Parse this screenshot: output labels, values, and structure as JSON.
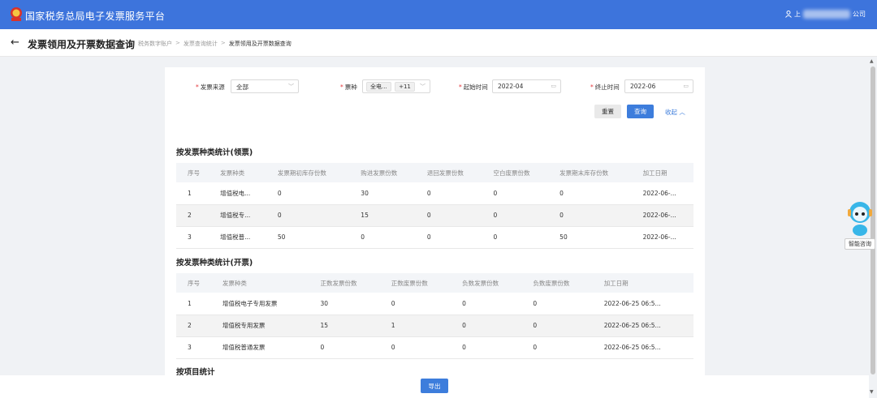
{
  "header": {
    "app_title": "国家税务总局电子发票服务平台",
    "user_prefix": "上",
    "user_suffix": "公司",
    "brand_color": "#3d74dc"
  },
  "pagebar": {
    "title": "发票领用及开票数据查询",
    "breadcrumb": [
      "税务数字账户",
      "发票查询统计",
      "发票领用及开票数据查询"
    ]
  },
  "filters": {
    "source": {
      "label": "发票来源",
      "value": "全部"
    },
    "type": {
      "label": "票种",
      "tag1": "全电...",
      "tag2": "+11"
    },
    "start": {
      "label": "起始时间",
      "value": "2022-04"
    },
    "end": {
      "label": "终止时间",
      "value": "2022-06"
    },
    "reset_label": "重置",
    "query_label": "查询",
    "collapse_label": "收起"
  },
  "section1": {
    "title": "按发票种类统计(领票)",
    "columns": [
      "序号",
      "发票种类",
      "发票期初库存份数",
      "购进发票份数",
      "退回发票份数",
      "空白废票份数",
      "发票期末库存份数",
      "加工日期"
    ],
    "rows": [
      [
        "1",
        "增值税电...",
        "0",
        "30",
        "0",
        "0",
        "0",
        "2022-06-..."
      ],
      [
        "2",
        "增值税专...",
        "0",
        "15",
        "0",
        "0",
        "0",
        "2022-06-..."
      ],
      [
        "3",
        "增值税普...",
        "50",
        "0",
        "0",
        "0",
        "50",
        "2022-06-..."
      ]
    ]
  },
  "section2": {
    "title": "按发票种类统计(开票)",
    "columns": [
      "序号",
      "发票种类",
      "正数发票份数",
      "正数废票份数",
      "负数发票份数",
      "负数废票份数",
      "加工日期"
    ],
    "rows": [
      [
        "1",
        "增值税电子专用发票",
        "30",
        "0",
        "0",
        "0",
        "2022-06-25 06:5..."
      ],
      [
        "2",
        "增值税专用发票",
        "15",
        "1",
        "0",
        "0",
        "2022-06-25 06:5..."
      ],
      [
        "3",
        "增值税普通发票",
        "0",
        "0",
        "0",
        "0",
        "2022-06-25 06:5..."
      ]
    ]
  },
  "section3": {
    "title": "按项目统计"
  },
  "footer": {
    "export_label": "导出"
  },
  "assistant": {
    "label": "智能咨询"
  }
}
